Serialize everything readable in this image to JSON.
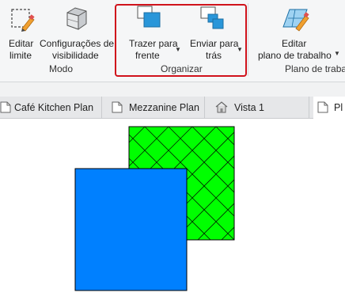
{
  "ribbon": {
    "buttons": {
      "edit_boundary": {
        "line1": "Editar",
        "line2": "limite"
      },
      "visibility_settings": {
        "line1": "Configurações de",
        "line2": "visibilidade"
      },
      "bring_to_front": {
        "line1": "Trazer para",
        "line2": "frente"
      },
      "send_to_back": {
        "line1": "Enviar para",
        "line2": "trás"
      },
      "edit_work_plane": {
        "line1": "Editar",
        "line2": "plano de trabalho"
      }
    },
    "panels": {
      "mode": "Modo",
      "arrange": "Organizar",
      "work_plane": "Plano de trabalho"
    }
  },
  "tabs": [
    {
      "label": "Café Kitchen Plan",
      "icon": "floor-plan-icon"
    },
    {
      "label": "Mezzanine Plan",
      "icon": "floor-plan-icon"
    },
    {
      "label": "Vista 1",
      "icon": "house-3d-view-icon"
    },
    {
      "label": "Pl",
      "icon": "floor-plan-icon"
    }
  ],
  "colors": {
    "front_square_fill": "#0080ff",
    "back_square_fill": "#00ff00",
    "highlight_border": "#d0121b",
    "ribbon_icon_blue": "#2996d9"
  }
}
